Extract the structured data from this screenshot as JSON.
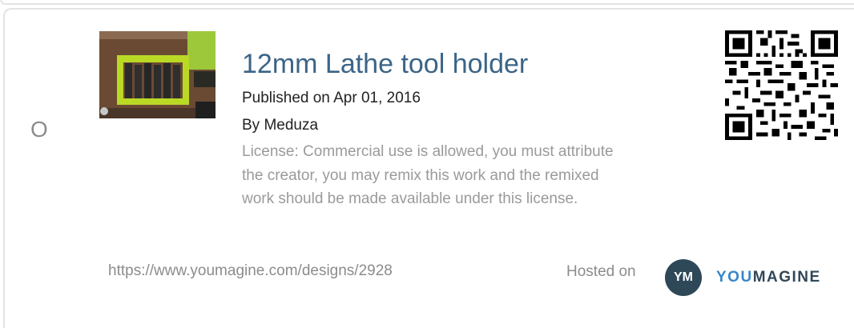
{
  "design": {
    "index_letter": "O",
    "title": "12mm Lathe tool holder",
    "published": "Published on Apr 01, 2016",
    "author": "By Meduza",
    "license": "License: Commercial use is allowed, you must attribute the creator, you may remix this work and the remixed work should be made available under this license.",
    "url": "https://www.youmagine.com/designs/2928"
  },
  "footer": {
    "hosted_label": "Hosted on",
    "badge_text": "YM",
    "brand_you": "YOU",
    "brand_magine": "MAGINE"
  },
  "icons": {
    "thumbnail": "tool-holder-photo",
    "qr": "qr-code-icon",
    "logo": "youmagine-logo"
  },
  "colors": {
    "title": "#3b6487",
    "brand_you": "#3a86c8",
    "brand_dark": "#2f4858"
  }
}
